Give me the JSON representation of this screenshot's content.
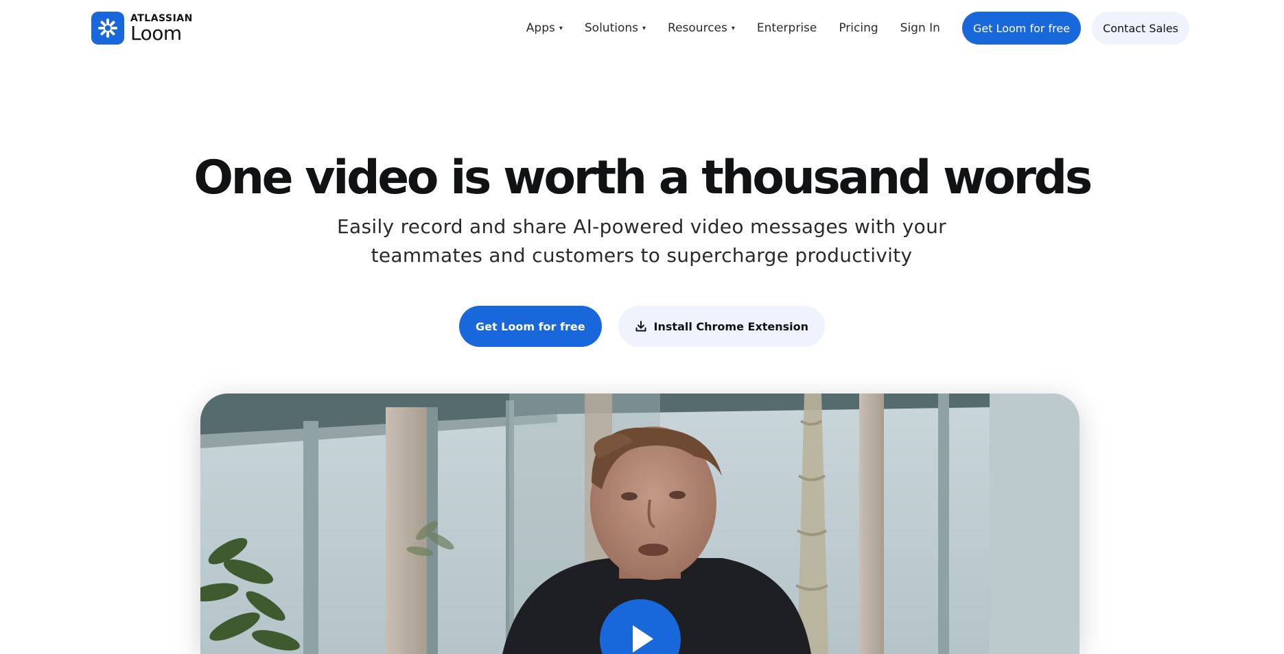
{
  "brand": {
    "company": "ATLASSIAN",
    "product": "Loom",
    "accent_color": "#1868db",
    "secondary_bg": "#eef3fd"
  },
  "nav": {
    "items": [
      {
        "label": "Apps",
        "has_dropdown": true
      },
      {
        "label": "Solutions",
        "has_dropdown": true
      },
      {
        "label": "Resources",
        "has_dropdown": true
      },
      {
        "label": "Enterprise",
        "has_dropdown": false
      },
      {
        "label": "Pricing",
        "has_dropdown": false
      },
      {
        "label": "Sign In",
        "has_dropdown": false
      }
    ],
    "cta_primary": "Get Loom for free",
    "cta_secondary": "Contact Sales",
    "caret": "▾"
  },
  "hero": {
    "title": "One video is worth a thousand words",
    "subtitle_line1": "Easily record and share AI-powered video messages with your",
    "subtitle_line2": "teammates and customers to supercharge productivity",
    "cta_primary": "Get Loom for free",
    "cta_secondary": "Install Chrome Extension",
    "cta_secondary_icon": "download-icon"
  },
  "video": {
    "play_icon": "play-icon"
  }
}
